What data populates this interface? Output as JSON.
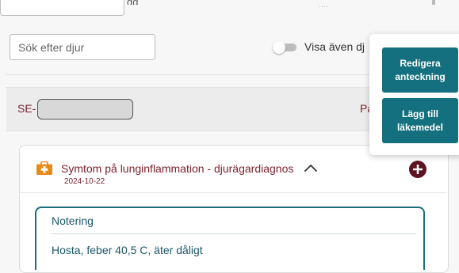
{
  "top": {
    "fragment": "gg",
    "dots": "...."
  },
  "search": {
    "placeholder": "Sök efter djur"
  },
  "toggle": {
    "label": "Visa även dj",
    "checked": false
  },
  "header": {
    "id_prefix": "SE-",
    "right_fragment": "Pa"
  },
  "symptom": {
    "icon": "first-aid-kit-icon",
    "title": "Symtom på lunginflammation - djurägardiagnos",
    "date": "2024-10-22",
    "expanded": true
  },
  "note": {
    "title": "Notering",
    "text": "Hosta, feber 40,5 C, äter dåligt"
  },
  "menu": {
    "edit_note_label": "Redigera anteckning",
    "add_medicine_label": "Lägg till läkemedel"
  },
  "colors": {
    "accent_maroon": "#7a1f2b",
    "plus_button": "#5c1420",
    "teal_button": "#14707e",
    "note_border": "#1b6d7a",
    "first_aid_orange": "#e88a1a"
  }
}
